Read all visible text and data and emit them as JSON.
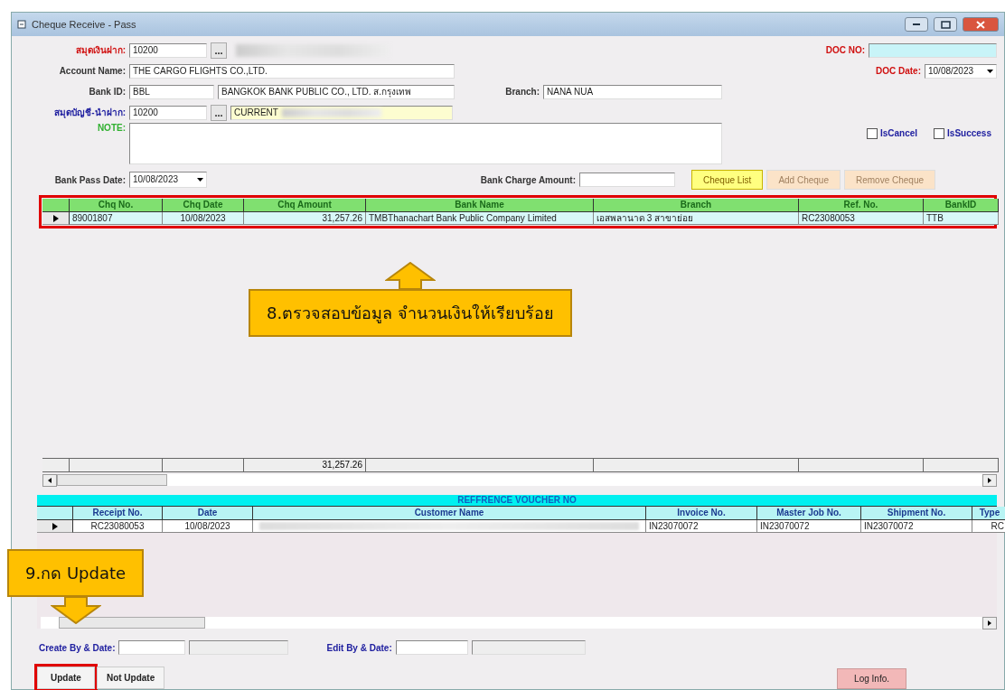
{
  "window": {
    "title": "Cheque Receive - Pass"
  },
  "form": {
    "deposit_book": {
      "label": "สมุดเงินฝาก:",
      "value": "10200",
      "browse": "...",
      "redacted": true
    },
    "account_name": {
      "label": "Account Name:",
      "value": "THE CARGO FLIGHTS CO.,LTD."
    },
    "bank_id": {
      "label": "Bank ID:",
      "value": "BBL",
      "bank_name": "BANGKOK BANK PUBLIC CO., LTD. ส.กรุงเทพ"
    },
    "branch": {
      "label": "Branch:",
      "value": "NANA NUA"
    },
    "account_book": {
      "label": "สมุดบัญชี-นำฝาก:",
      "value": "10200",
      "account_type": "CURRENT",
      "browse": "...",
      "redacted": true
    },
    "note": {
      "label": "NOTE:"
    },
    "doc_no": {
      "label": "DOC NO:"
    },
    "doc_date": {
      "label": "DOC Date:",
      "value": "10/08/2023"
    },
    "checkboxes": [
      {
        "label": "IsCancel",
        "checked": false
      },
      {
        "label": "IsSuccess",
        "checked": false
      }
    ],
    "bank_pass_date": {
      "label": "Bank Pass Date:",
      "value": "10/08/2023"
    },
    "bank_charge_amount": {
      "label": "Bank Charge Amount:"
    }
  },
  "cheque_buttons": [
    {
      "label": "Cheque List",
      "selected": true
    },
    {
      "label": "Add Cheque",
      "selected": false
    },
    {
      "label": "Remove Cheque",
      "selected": false
    }
  ],
  "cheque_grid": {
    "highlighted": true,
    "columns": [
      "Chq No.",
      "Chq Date",
      "Chq Amount",
      "Bank Name",
      "Branch",
      "Ref. No.",
      "BankID"
    ],
    "rows": [
      {
        "selected": true,
        "cells": [
          {
            "kind": "text",
            "text": "89001807"
          },
          {
            "kind": "text",
            "text": "10/08/2023"
          },
          {
            "kind": "text",
            "text": "31,257.26"
          },
          {
            "kind": "text",
            "text": "TMBThanachart Bank Public Company Limited"
          },
          {
            "kind": "text",
            "text": "เอสพลานาด 3 สาขาย่อย"
          },
          {
            "kind": "text",
            "text": "RC23080053"
          },
          {
            "kind": "text",
            "text": "TTB"
          }
        ]
      }
    ],
    "total_amount": "31,257.26"
  },
  "reference": {
    "title": "REFFRENCE VOUCHER NO",
    "columns": [
      "Receipt No.",
      "Date",
      "Customer Name",
      "Invoice No.",
      "Master Job No.",
      "Shipment No.",
      "Type"
    ],
    "rows": [
      {
        "selected": true,
        "cells": [
          {
            "kind": "text",
            "text": "RC23080053"
          },
          {
            "kind": "text",
            "text": "10/08/2023"
          },
          {
            "kind": "redacted"
          },
          {
            "kind": "text",
            "text": "IN23070072"
          },
          {
            "kind": "text",
            "text": "IN23070072"
          },
          {
            "kind": "text",
            "text": "IN23070072"
          },
          {
            "kind": "text",
            "text": "RC"
          }
        ]
      }
    ]
  },
  "audit": {
    "create_label": "Create By & Date:",
    "edit_label": "Edit By & Date:"
  },
  "footer_buttons": [
    {
      "label": "Update",
      "highlighted": true
    },
    {
      "label": "Not Update",
      "highlighted": false
    }
  ],
  "log_button": {
    "label": "Log Info."
  },
  "callouts": [
    {
      "text": "8.ตรวจสอบข้อมูล จำนวนเงินให้เรียบร้อย",
      "kind": "up"
    },
    {
      "text": "9.กด Update",
      "kind": "down"
    }
  ]
}
